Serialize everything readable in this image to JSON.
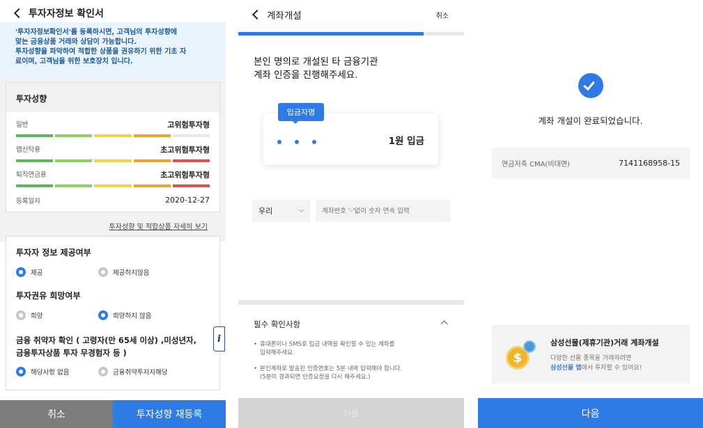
{
  "panel1": {
    "title": "투자자정보 확인서",
    "info_lines": [
      "'투자자정보확인서'를 등록하시면, 고객님의 투자성향에",
      "맞는 금융상품 거래와 상담이 가능합니다.",
      "투자성향을 파악하여 적합한 상품을 권유하기 위한 기초 자",
      "료이며, 고객님을 위한 보호장치 입니다."
    ],
    "profile_title": "투자성향",
    "rows": [
      {
        "label": "일반",
        "value": "고위험투자형",
        "level": 4
      },
      {
        "label": "랩신탁용",
        "value": "초고위험투자형",
        "level": 5
      },
      {
        "label": "퇴직연금용",
        "value": "초고위험투자형",
        "level": 5
      }
    ],
    "reg_label": "등록일자",
    "reg_date": "2020-12-27",
    "detail_link": "투자성향 및 적합상품 자세히 보기",
    "q1": "투자자 정보 제공여부",
    "q1_opt1": "제공",
    "q1_opt2": "제공하지않음",
    "q1_selected": 1,
    "q2": "투자권유 희망여부",
    "q2_opt1": "희망",
    "q2_opt2": "희망하지 않음",
    "q2_selected": 2,
    "q3_line1": "금융 취약자 확인 ( 고령자(만 65세 이상) ,미성년자,",
    "q3_line2": "금융투자상품 투자 무경험자 등 )",
    "q3_opt1": "해당사항 없음",
    "q3_opt2": "금융취약투자자해당",
    "q3_selected": 1,
    "info_icon": "i",
    "cancel": "취소",
    "reregister": "투자성향 재등록"
  },
  "panel2": {
    "title": "계좌개설",
    "cancel": "취소",
    "progress": 0.82,
    "heading1": "본인 명의로 개설된 타 금융기관",
    "heading2": "계좌 인증을 진행해주세요.",
    "tooltip": "입금자명",
    "deposit": "1원 입금",
    "bank": "우리",
    "account_placeholder": "계좌번호 '-'없이 숫자 연속 입력",
    "notice_title": "필수 확인사항",
    "notes": [
      [
        "휴대폰이나 SMS로 입금 내역을 확인할 수 있는 계좌를",
        "입력해주세요."
      ],
      [
        "본인계좌로 발송된 인증번호는 5분 내에 입력해야 합니다.",
        "(5분이 경과되면 인증요청을 다시 해주세요.)"
      ]
    ],
    "next": "다음"
  },
  "panel3": {
    "done": "계좌 개설이 완료되었습니다.",
    "account_type": "연금저축 CMA(비대면)",
    "account_no": "7141168958-15",
    "promo_title": "삼성선물(제휴기관)거래 계좌개설",
    "promo_l1": "다양한 선물 종목을 거래하려면",
    "promo_link": "삼성선물 앱",
    "promo_l2": "에서 투자할 수 있어요!",
    "next": "다음"
  },
  "colors": {
    "accent": "#2f7be5",
    "bar": [
      "#5cb85c",
      "#8fd05a",
      "#f0d24a",
      "#f0a030",
      "#e05050"
    ]
  }
}
